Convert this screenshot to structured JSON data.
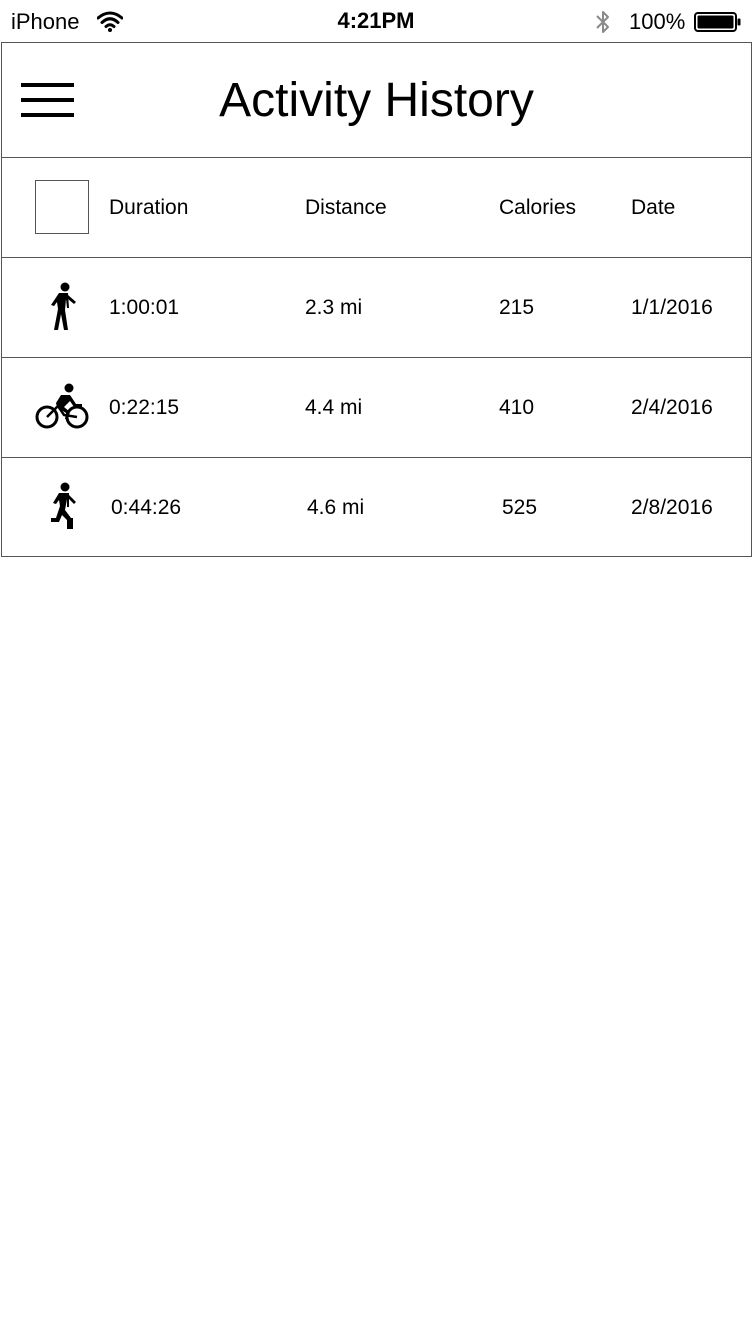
{
  "status_bar": {
    "carrier": "iPhone",
    "time": "4:21PM",
    "battery_percent": "100%",
    "wifi_icon": "wifi-icon",
    "bluetooth_icon": "bluetooth-icon",
    "battery_icon": "battery-full-icon"
  },
  "header": {
    "title": "Activity History",
    "menu_icon": "hamburger-menu-icon"
  },
  "table": {
    "columns": {
      "duration": "Duration",
      "distance": "Distance",
      "calories": "Calories",
      "date": "Date"
    },
    "rows": [
      {
        "icon": "walking-icon",
        "duration": "1:00:01",
        "distance": "2.3 mi",
        "calories": "215",
        "date": "1/1/2016"
      },
      {
        "icon": "cycling-icon",
        "duration": "0:22:15",
        "distance": "4.4 mi",
        "calories": "410",
        "date": "2/4/2016"
      },
      {
        "icon": "running-icon",
        "duration": "0:44:26",
        "distance": "4.6 mi",
        "calories": "525",
        "date": "2/8/2016"
      }
    ]
  }
}
